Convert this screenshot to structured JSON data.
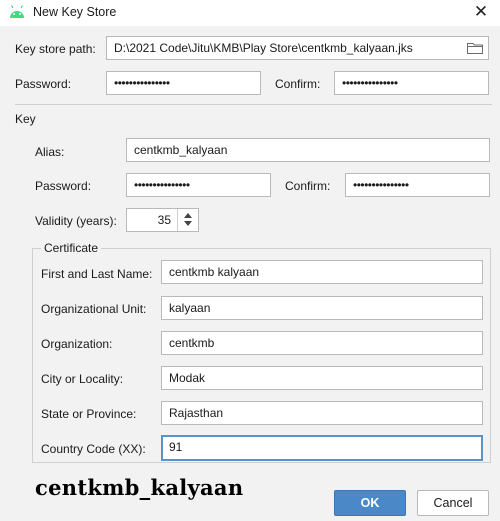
{
  "window": {
    "title": "New Key Store",
    "app_icon": "android-icon",
    "close_glyph": "✕"
  },
  "keystore": {
    "path_label": "Key store path:",
    "path_value": "D:\\2021 Code\\Jitu\\KMB\\Play Store\\centkmb_kalyaan.jks",
    "browse_icon": "folder-icon",
    "password_label": "Password:",
    "password_value": "•••••••••••••••",
    "confirm_label": "Confirm:",
    "confirm_value": "•••••••••••••••"
  },
  "key": {
    "section_label": "Key",
    "alias_label": "Alias:",
    "alias_value": "centkmb_kalyaan",
    "password_label": "Password:",
    "password_value": "•••••••••••••••",
    "confirm_label": "Confirm:",
    "confirm_value": "•••••••••••••••",
    "validity_label": "Validity (years):",
    "validity_value": "35"
  },
  "certificate": {
    "group_label": "Certificate",
    "fields": [
      {
        "label": "First and Last Name:",
        "value": "centkmb kalyaan"
      },
      {
        "label": "Organizational Unit:",
        "value": "kalyaan"
      },
      {
        "label": "Organization:",
        "value": "centkmb"
      },
      {
        "label": "City or Locality:",
        "value": "Modak"
      },
      {
        "label": "State or Province:",
        "value": "Rajasthan"
      },
      {
        "label": "Country Code (XX):",
        "value": "91"
      }
    ]
  },
  "watermark_text": "centkmb_kalyaan",
  "buttons": {
    "ok_label": "OK",
    "cancel_label": "Cancel"
  },
  "colors": {
    "accent": "#4a88c7",
    "android_green": "#3ddc84",
    "focus_border": "#5a93cc"
  }
}
